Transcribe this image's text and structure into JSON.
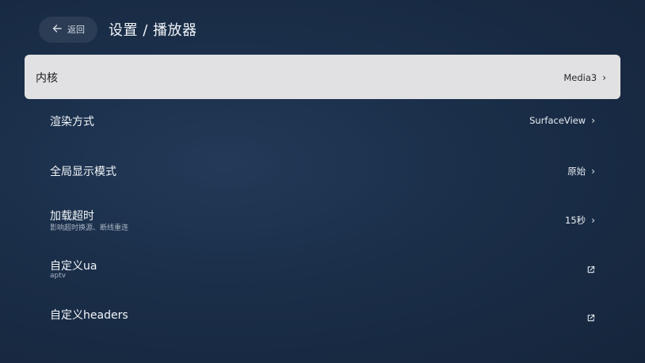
{
  "header": {
    "back_label": "返回",
    "title": "设置 / 播放器"
  },
  "settings": [
    {
      "title": "内核",
      "value": "Media3",
      "icon": "chevron-right-icon",
      "focused": true
    },
    {
      "title": "渲染方式",
      "value": "SurfaceView",
      "icon": "chevron-right-icon"
    },
    {
      "title": "全局显示模式",
      "value": "原始",
      "icon": "chevron-right-icon"
    },
    {
      "title": "加载超时",
      "subtitle": "影响超时换源、断线重连",
      "value": "15秒",
      "icon": "chevron-right-icon"
    },
    {
      "title": "自定义ua",
      "subtitle": "aptv",
      "icon": "external-link-icon"
    },
    {
      "title": "自定义headers",
      "icon": "external-link-icon"
    }
  ]
}
